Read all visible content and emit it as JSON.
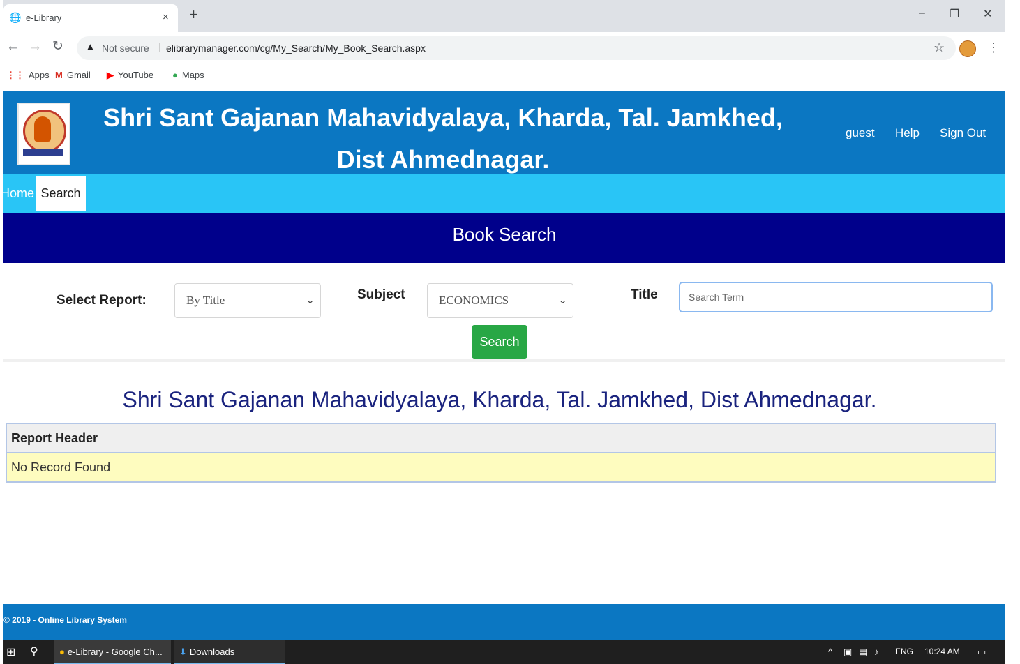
{
  "browser": {
    "tab_title": "e-Library",
    "tab_close": "×",
    "new_tab": "+",
    "minimize": "–",
    "restore": "❐",
    "close": "✕",
    "not_secure": "Not secure",
    "url": "elibrarymanager.com/cg/My_Search/My_Book_Search.aspx",
    "bookmarks": [
      {
        "label": "Apps",
        "icon": "apps-grid-icon"
      },
      {
        "label": "Gmail",
        "icon": "gmail-icon"
      },
      {
        "label": "YouTube",
        "icon": "youtube-icon"
      },
      {
        "label": "Maps",
        "icon": "maps-pin-icon"
      }
    ]
  },
  "site": {
    "title": "Shri Sant Gajanan Mahavidyalaya, Kharda, Tal. Jamkhed, Dist Ahmednagar.",
    "links": {
      "guest": "guest",
      "help": "Help",
      "signout": "Sign Out"
    },
    "menu": {
      "home": "Home",
      "search": "Search"
    }
  },
  "page": {
    "heading": "Book Search",
    "select_report_label": "Select Report:",
    "select_report_value": "By Title",
    "subject_label": "Subject",
    "subject_value": "ECONOMICS",
    "title_label": "Title",
    "title_placeholder": "Search Term",
    "search_button": "Search"
  },
  "report": {
    "title": "Shri Sant Gajanan Mahavidyalaya, Kharda, Tal. Jamkhed, Dist Ahmednagar.",
    "header": "Report Header",
    "empty_message": "No Record Found"
  },
  "footer": {
    "text": "© 2019 - Online Library System"
  },
  "taskbar": {
    "chrome_item": "e-Library - Google Ch...",
    "downloads_item": "Downloads",
    "lang": "ENG",
    "time": "10:24 AM"
  },
  "colors": {
    "header_blue": "#0b77c2",
    "menu_cyan": "#29c5f6",
    "heading_navy": "#00008b",
    "search_green": "#28a745",
    "no_record_yellow": "#fefcbf"
  }
}
